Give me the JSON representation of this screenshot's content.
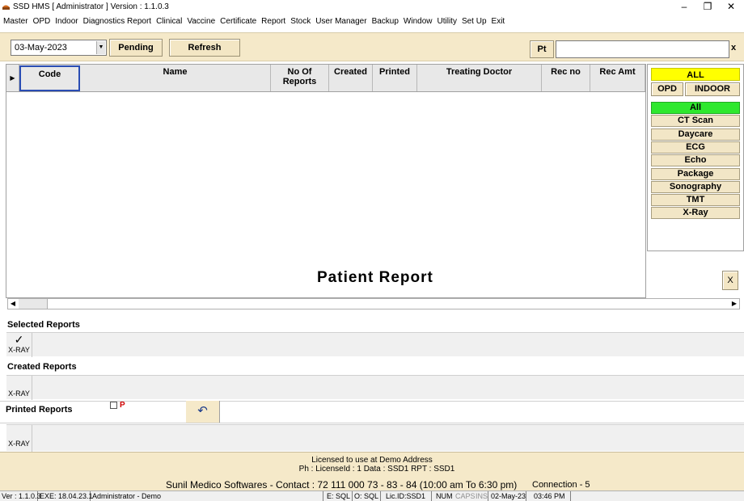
{
  "window": {
    "title": "SSD HMS [ Administrator ] Version : 1.1.0.3",
    "minimize": "–",
    "restore": "❐",
    "close": "✕"
  },
  "menu": [
    "Master",
    "OPD",
    "Indoor",
    "Diagnostics Report",
    "Clinical",
    "Vaccine",
    "Certificate",
    "Report",
    "Stock",
    "User Manager",
    "Backup",
    "Window",
    "Utility",
    "Set Up",
    "Exit"
  ],
  "toolbar": {
    "date_value": "03-May-2023",
    "pending_label": "Pending",
    "refresh_label": "Refresh",
    "pt_label": "Pt",
    "pt_value": "",
    "clear_label": "x"
  },
  "grid": {
    "columns": [
      "Code",
      "Name",
      "No Of Reports",
      "Created",
      "Printed",
      "Treating Doctor",
      "Rec no",
      "Rec Amt"
    ],
    "rows": []
  },
  "filter_panel": {
    "all_top": "ALL",
    "opd_label": "OPD",
    "indoor_label": "INDOOR",
    "categories": [
      "All",
      "CT Scan",
      "Daycare",
      "ECG",
      "Echo",
      "Package",
      "Sonography",
      "TMT",
      "X-Ray"
    ],
    "selected_category": "All",
    "colors": {
      "all_top": "#ffff00",
      "selected": "#2ee82e"
    }
  },
  "patient_report": {
    "title": "Patient Report",
    "close_label": "X"
  },
  "sections": {
    "selected_label": "Selected Reports",
    "selected_tab": "X-RAY",
    "selected_check": "✓",
    "created_label": "Created Reports",
    "created_tab": "X-RAY",
    "printed_label": "Printed Reports",
    "printed_p": "P",
    "printed_tab": "X-RAY"
  },
  "footer": {
    "license_line1": "Licensed to use at Demo Address",
    "license_line2": "Ph :   LicenseId : 1  Data : SSD1 RPT : SSD1",
    "company": "Sunil Medico Softwares - Contact : 72 111 000 73 - 83 - 84  (10:00 am To 6:30 pm)",
    "connection": "Connection - 5"
  },
  "statusbar": {
    "ver": "Ver : 1.1.0.3",
    "exe": "EXE: 18.04.23.1",
    "user": "Administrator - Demo",
    "e_sql": "E: SQL",
    "o_sql": "O: SQL",
    "lic": "Lic.ID:SSD1",
    "num": "NUM",
    "caps": "CAPS",
    "ins": "INS",
    "date": "02-May-23",
    "time": "03:46 PM"
  }
}
